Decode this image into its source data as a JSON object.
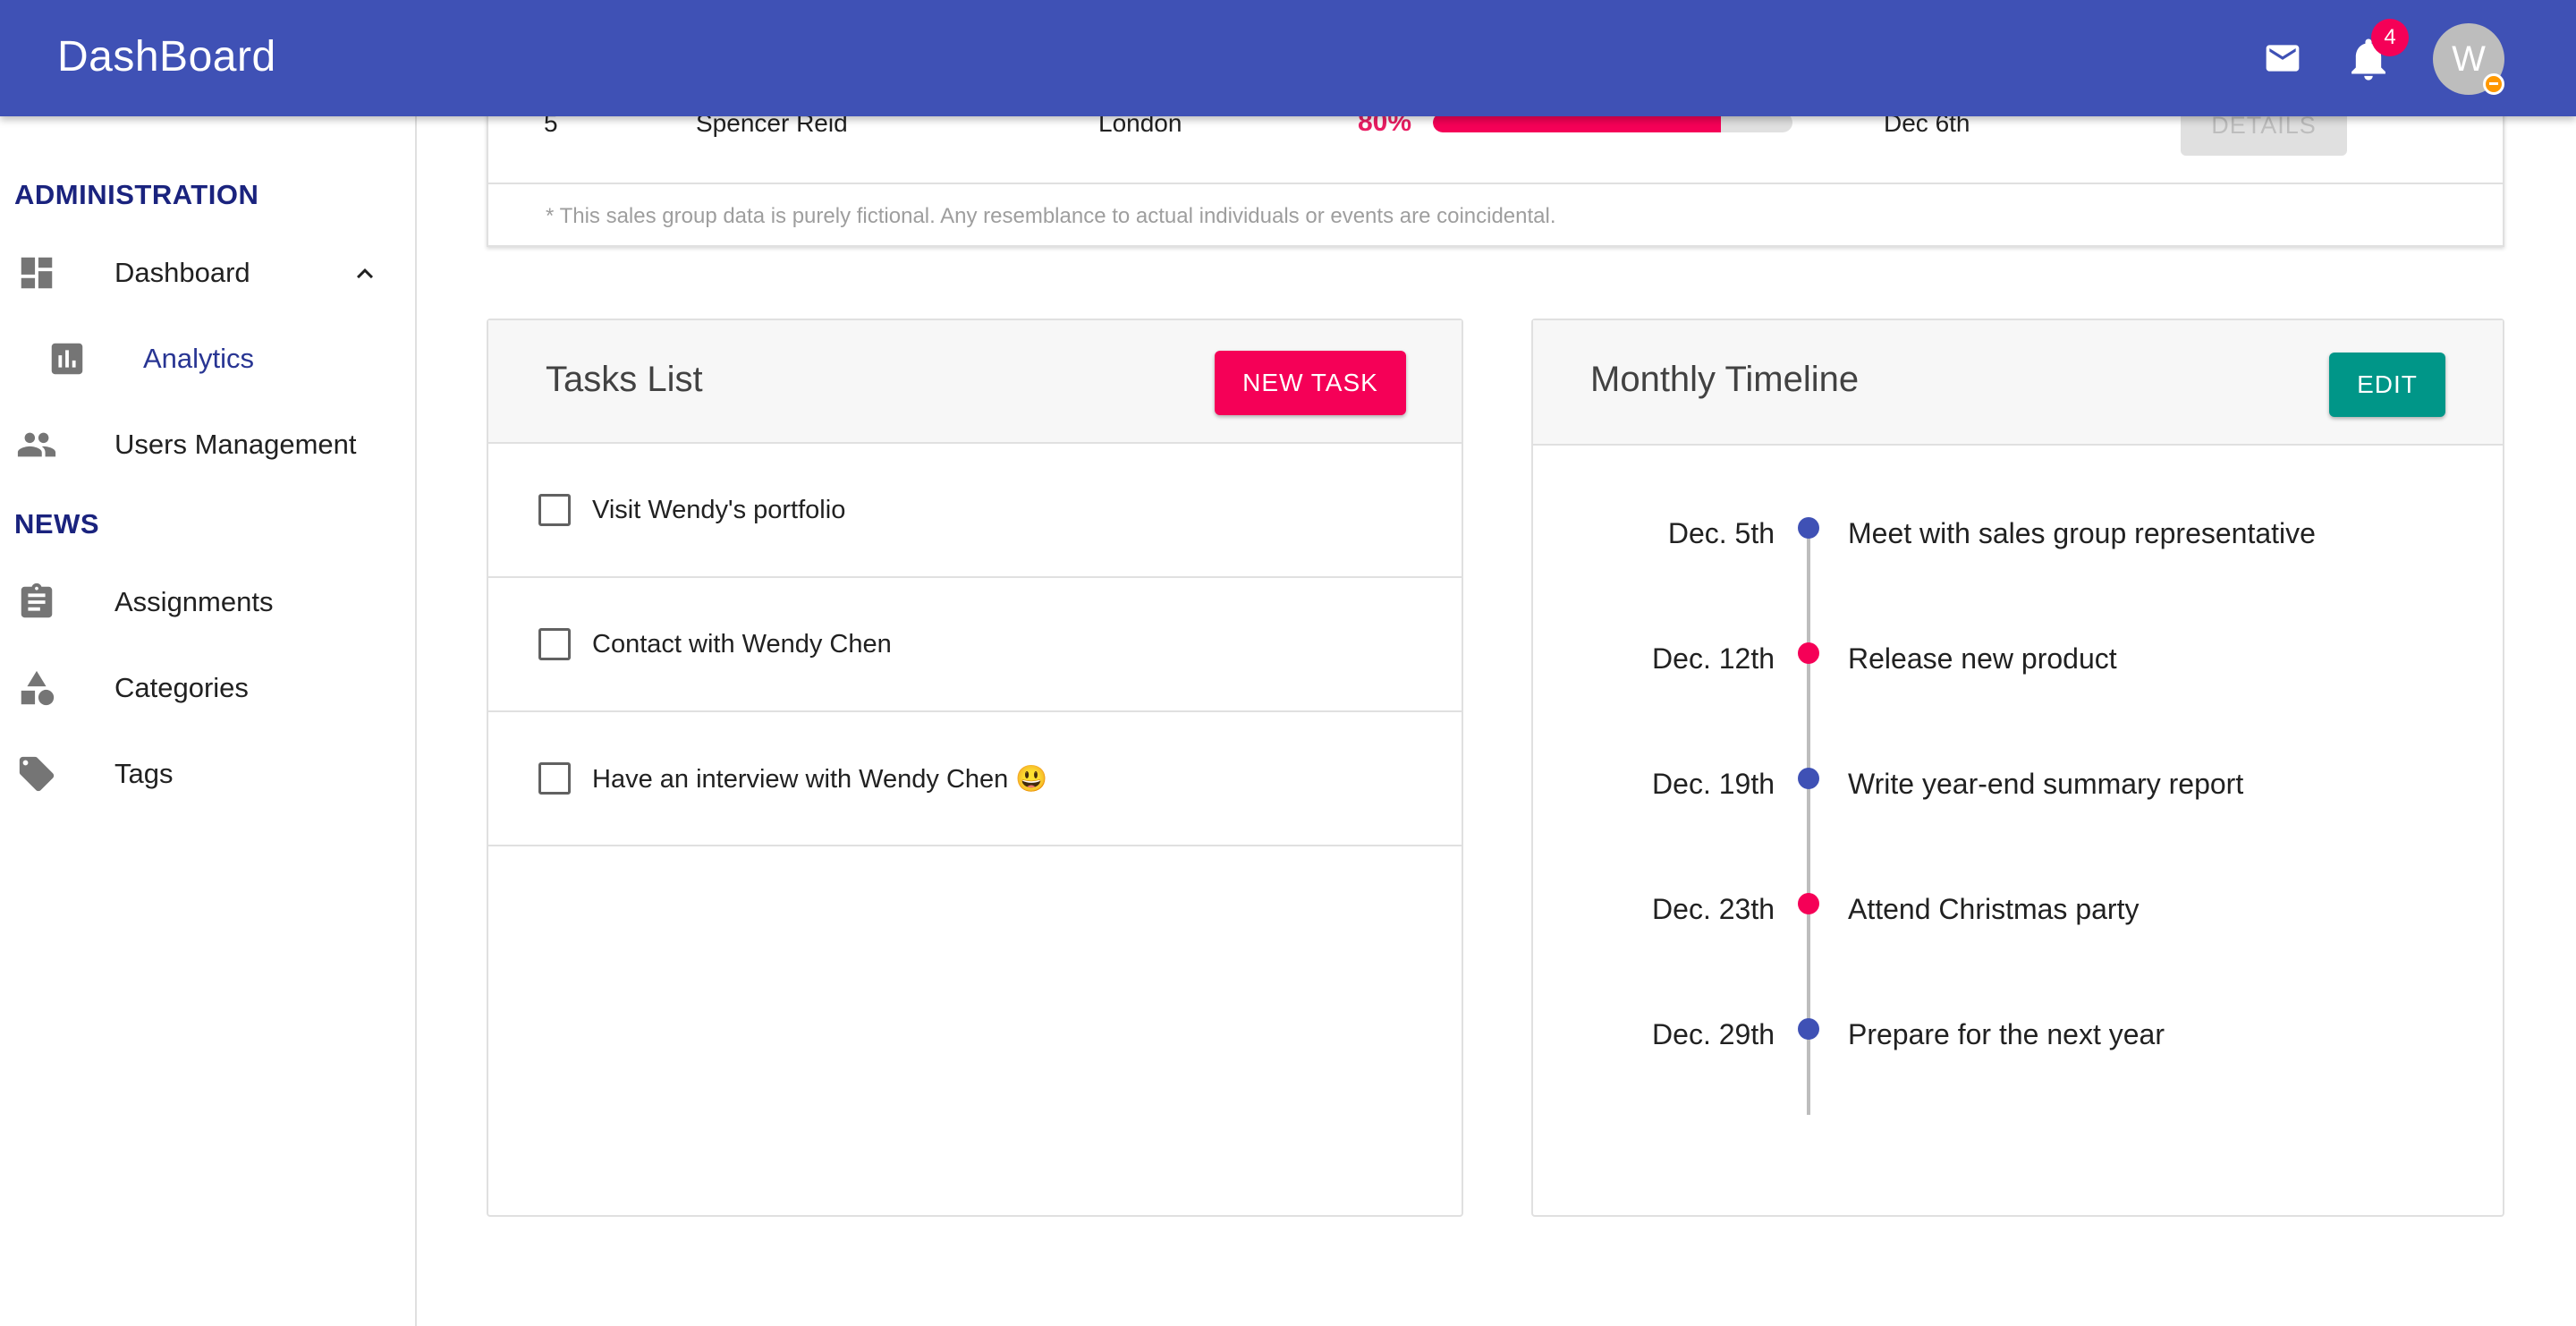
{
  "appbar": {
    "title": "DashBoard",
    "notification_count": "4",
    "avatar_initial": "W",
    "color": "#3f51b5"
  },
  "sidebar": {
    "sections": [
      {
        "heading": "ADMINISTRATION"
      },
      {
        "heading": "NEWS"
      }
    ],
    "items": [
      {
        "label": "Dashboard",
        "icon": "dashboard-icon"
      },
      {
        "label": "Analytics",
        "icon": "bar-chart-icon"
      },
      {
        "label": "Users Management",
        "icon": "people-icon"
      },
      {
        "label": "Assignments",
        "icon": "clipboard-icon"
      },
      {
        "label": "Categories",
        "icon": "shapes-icon"
      },
      {
        "label": "Tags",
        "icon": "tag-icon"
      }
    ]
  },
  "sales": {
    "row": {
      "id": "5",
      "name": "Spencer Reid",
      "city": "London",
      "progress_label": "80%",
      "progress": 0.8,
      "date": "Dec 6th",
      "action": "DETAILS"
    },
    "footnote": "* This sales group data is purely fictional. Any resemblance to actual individuals or events are coincidental."
  },
  "tasks": {
    "title": "Tasks List",
    "new_button": "NEW TASK",
    "items": [
      {
        "label": "Visit Wendy's portfolio"
      },
      {
        "label": "Contact with Wendy Chen"
      },
      {
        "label": "Have an interview with Wendy Chen 😃"
      }
    ]
  },
  "timeline": {
    "title": "Monthly Timeline",
    "edit_button": "EDIT",
    "events": [
      {
        "date": "Dec. 5th",
        "text": "Meet with sales group representative",
        "color": "#3f51b5"
      },
      {
        "date": "Dec. 12th",
        "text": "Release new product",
        "color": "#f50057"
      },
      {
        "date": "Dec. 19th",
        "text": "Write year-end summary report",
        "color": "#3f51b5"
      },
      {
        "date": "Dec. 23th",
        "text": "Attend Christmas party",
        "color": "#f50057"
      },
      {
        "date": "Dec. 29th",
        "text": "Prepare for the next year",
        "color": "#3f51b5"
      }
    ]
  },
  "colors": {
    "primary": "#3f51b5",
    "secondary": "#f50057",
    "teal": "#009688"
  }
}
